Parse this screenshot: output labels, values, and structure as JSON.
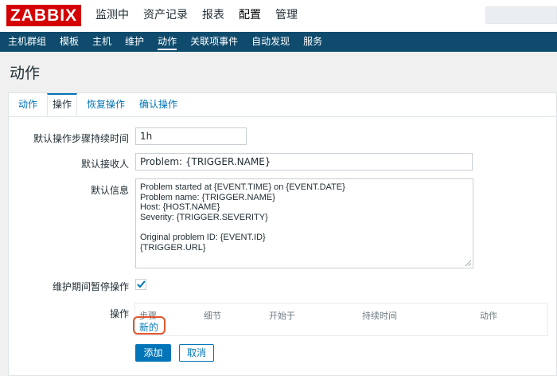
{
  "brand": {
    "logo_text": "ZABBIX",
    "color": "#d40000"
  },
  "main_menu": [
    "监测中",
    "资产记录",
    "报表",
    "配置",
    "管理"
  ],
  "sub_menu": [
    "主机群组",
    "模板",
    "主机",
    "维护",
    "动作",
    "关联项事件",
    "自动发现",
    "服务"
  ],
  "page_title": "动作",
  "tabs": [
    "动作",
    "操作",
    "恢复操作",
    "确认操作"
  ],
  "form": {
    "step_duration": {
      "label": "默认操作步骤持续时间",
      "value": "1h"
    },
    "subject": {
      "label": "默认接收人",
      "value": "Problem: {TRIGGER.NAME}"
    },
    "message": {
      "label": "默认信息",
      "value": "Problem started at {EVENT.TIME} on {EVENT.DATE}\nProblem name: {TRIGGER.NAME}\nHost: {HOST.NAME}\nSeverity: {TRIGGER.SEVERITY}\n\nOriginal problem ID: {EVENT.ID}\n{TRIGGER.URL}"
    },
    "pause": {
      "label": "维护期间暂停操作",
      "checked": true
    },
    "operations": {
      "label": "操作",
      "columns": [
        "步骤",
        "细节",
        "开始于",
        "持续时间",
        "动作"
      ],
      "new_link": "新的"
    }
  },
  "buttons": {
    "add": "添加",
    "cancel": "取消"
  },
  "colors": {
    "header_bg": "#0e4b6d",
    "link": "#0275b8",
    "highlight": "#e15630"
  }
}
